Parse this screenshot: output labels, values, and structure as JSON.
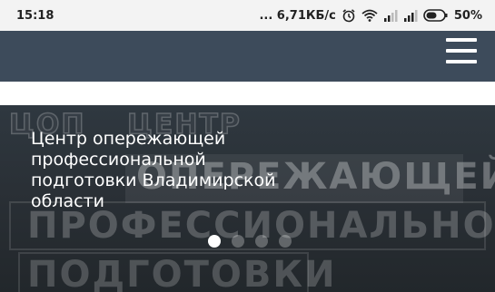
{
  "status_bar": {
    "time": "15:18",
    "speed": "... 6,71КБ/с",
    "battery": "50%",
    "icons": [
      "alarm-icon",
      "wifi-icon",
      "signal-icon",
      "signal-icon",
      "battery-icon"
    ]
  },
  "header": {
    "background_color": "#3d4b5b",
    "menu_icon": "hamburger-menu-icon"
  },
  "hero": {
    "title": "Центр опережающей профессиональной подготовки Владимирской области",
    "background_words": [
      "ЦОП",
      "ЦЕНТР",
      "ОПЕРЕЖАЮЩЕЙ",
      "ПРОФЕССИОНАЛЬНОЙ",
      "ПОДГОТОВКИ"
    ],
    "slides_total": 4,
    "active_slide": 1
  }
}
